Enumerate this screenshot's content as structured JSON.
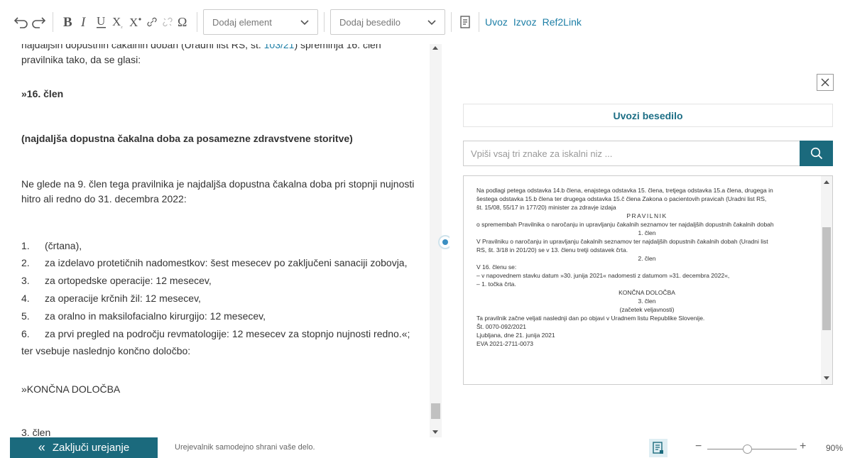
{
  "toolbar": {
    "element_select": "Dodaj element",
    "text_select": "Dodaj besedilo",
    "links": [
      "Uvoz",
      "Izvoz",
      "Ref2Link"
    ]
  },
  "editor": {
    "line_top_a": "najdaljših dopustnih čakalnih dobah (Uradni list RS, št. ",
    "line_top_link": "103/21",
    "line_top_b": ") spreminja 16. člen",
    "line2": "pravilnika tako, da se glasi:",
    "heading_clen": "»16. člen",
    "heading_title": "(najdaljša dopustna čakalna doba za posamezne zdravstvene storitve)",
    "para1_l1": "Ne glede na 9. člen tega pravilnika je najdaljša dopustna čakalna doba pri stopnji nujnosti",
    "para1_l2": "hitro ali redno do 31. decembra 2022:",
    "items": [
      {
        "num": "1.",
        "text": "(črtana),"
      },
      {
        "num": "2.",
        "text": "za izdelavo protetičnih nadomestkov: šest mesecev po zaključeni sanaciji zobovja,"
      },
      {
        "num": "3.",
        "text": "za ortopedske operacije: 12 mesecev,"
      },
      {
        "num": "4.",
        "text": "za operacije krčnih žil: 12 mesecev,"
      },
      {
        "num": "5.",
        "text": "za oralno in maksilofacialno kirurgijo: 12 mesecev,"
      },
      {
        "num": "6.",
        "text": "za prvi pregled na področju revmatologije: 12 mesecev za stopnjo nujnosti redno.«;"
      }
    ],
    "after_list": "ter vsebuje naslednjo končno določbo:",
    "final_heading": "»KONČNA DOLOČBA",
    "last_line": "3. člen"
  },
  "right_panel": {
    "import_label": "Uvozi besedilo",
    "search_placeholder": "Vpiši vsaj tri znake za iskalni niz ...",
    "doc_lines": [
      "Na podlagi petega odstavka 14.b člena, enajstega odstavka 15. člena, tretjega odstavka 15.a člena, drugega in",
      "šestega odstavka 15.b člena ter drugega odstavka 15.č člena Zakona o pacientovih pravicah (Uradni list RS,",
      "št. 15/08, 55/17 in 177/20) minister za zdravje izdaja",
      "PRAVILNIK",
      "o spremembah Pravilnika o naročanju in upravljanju čakalnih seznamov ter najdaljših dopustnih čakalnih dobah",
      "1. člen",
      "V Pravilniku o naročanju in upravljanju čakalnih seznamov ter najdaljših dopustnih čakalnih dobah (Uradni list",
      "RS, št. 3/18 in 201/20) se v 13. členu tretji odstavek črta.",
      "2. člen",
      "V 16. členu se:",
      "– v napovednem stavku datum »30. junija 2021« nadomesti z datumom »31. decembra 2022«,",
      "– 1. točka črta.",
      "KONČNA DOLOČBA",
      "3. člen",
      "(začetek veljavnosti)",
      "Ta pravilnik začne veljati naslednji dan po objavi v Uradnem listu Republike Slovenije.",
      "Št. 0070-092/2021",
      "Ljubljana, dne 21. junija 2021",
      "EVA 2021-2711-0073"
    ]
  },
  "footer": {
    "finish_label": "Zaključi urejanje",
    "finish_chevron": "«",
    "autosave_text": "Urejevalnik samodejno shrani vaše delo.",
    "zoom_minus": "−",
    "zoom_plus": "+",
    "zoom_value": "90%",
    "zoom_level": 0.45
  },
  "colors": {
    "accent": "#1b6a7d",
    "link": "#1c7ea6"
  }
}
